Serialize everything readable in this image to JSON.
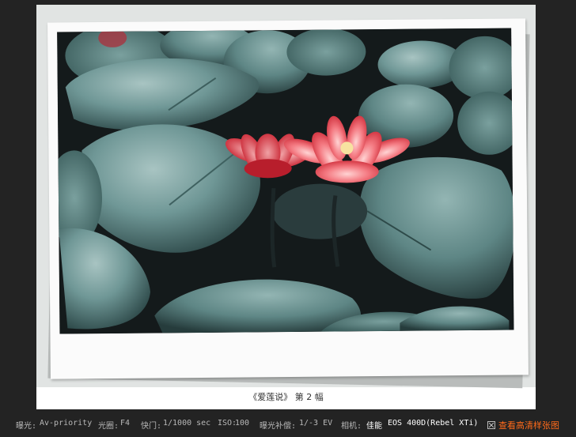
{
  "caption": "《爱莲说》 第 2 幅",
  "photo": {
    "description_icon": "lotus-photo"
  },
  "exif": {
    "exposure_label": "曝光:",
    "exposure_value": "Av-priority",
    "aperture_label": "光圈:",
    "aperture_value": "F4",
    "shutter_label": "快门:",
    "shutter_value": "1/1000 sec",
    "iso_label": "ISO:",
    "iso_value": "100",
    "ev_label": "曝光补偿:",
    "ev_value": "1/-3 EV",
    "camera_label": "相机:",
    "camera_brand": "佳能",
    "camera_model": "EOS 400D(Rebel XTi)"
  },
  "hd_link": "查看高清样张图",
  "colors": {
    "background": "#232323",
    "accent": "#ff6a1a",
    "leaf": "#5b8483",
    "flower": "#ee4a55"
  }
}
